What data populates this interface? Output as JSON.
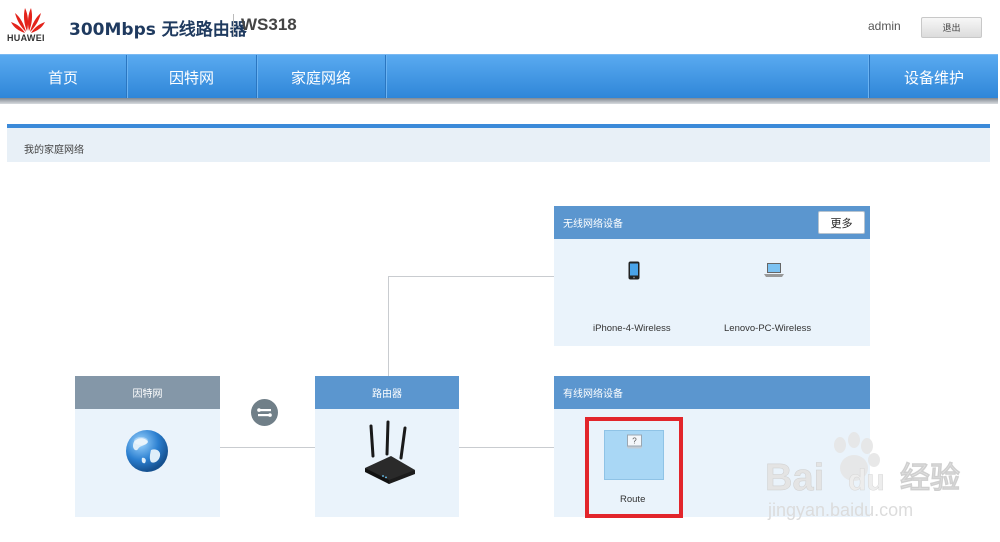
{
  "header": {
    "brand": "HUAWEI",
    "product_title": "300Mbps 无线路由器",
    "model": "WS318",
    "username": "admin",
    "logout_label": "退出"
  },
  "nav": {
    "items": [
      {
        "label": "首页"
      },
      {
        "label": "因特网"
      },
      {
        "label": "家庭网络"
      },
      {
        "label": "设备维护"
      }
    ]
  },
  "section": {
    "title": "我的家庭网络"
  },
  "topology": {
    "internet_card": {
      "title": "因特网",
      "icon": "globe-icon"
    },
    "router_card": {
      "title": "路由器",
      "icon": "router-icon"
    },
    "wireless_card": {
      "title": "无线网络设备",
      "more_label": "更多",
      "devices": [
        {
          "name": "iPhone-4-Wireless",
          "icon": "smartphone-icon"
        },
        {
          "name": "Lenovo-PC-Wireless",
          "icon": "laptop-icon"
        }
      ]
    },
    "wired_card": {
      "title": "有线网络设备",
      "devices": [
        {
          "name": "Route",
          "icon": "unknown-device-icon"
        }
      ]
    },
    "connection_icon": "connection-status-icon"
  },
  "colors": {
    "nav_blue": "#3b8ad9",
    "card_header_blue": "#5b96cf",
    "card_header_gray": "#8497a8",
    "card_body": "#eaf3fb",
    "highlight_red": "#e2252b",
    "brand_red": "#e3231b"
  },
  "watermark": {
    "brand": "Bai",
    "brand_suffix": "du",
    "cn_text": "经验",
    "url": "jingyan.baidu.com"
  }
}
